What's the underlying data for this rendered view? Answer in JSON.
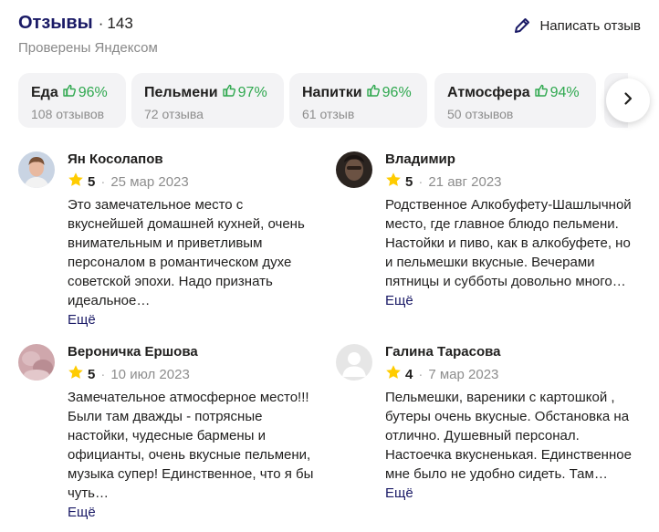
{
  "header": {
    "title": "Отзывы",
    "dot": "·",
    "count": "143",
    "verified": "Проверены Яндексом",
    "write_label": "Написать отзыв"
  },
  "chips": [
    {
      "name": "Еда",
      "percent": "96%",
      "sub": "108 отзывов"
    },
    {
      "name": "Пельмени",
      "percent": "97%",
      "sub": "72 отзыва"
    },
    {
      "name": "Напитки",
      "percent": "96%",
      "sub": "61 отзыв"
    },
    {
      "name": "Атмосфера",
      "percent": "94%",
      "sub": "50 отзывов"
    }
  ],
  "reviews": [
    {
      "author": "Ян Косолапов",
      "rating": "5",
      "date": "25 мар 2023",
      "text": "Это замечательное место с вкуснейшей домашней кухней, очень внимательным и приветливым персоналом в романтическом духе советской эпохи. Надо признать идеальное…",
      "more": "Ещё"
    },
    {
      "author": "Владимир",
      "rating": "5",
      "date": "21 авг 2023",
      "text": "Родственное Алкобуфету-Шашлычной место, где главное блюдо пельмени. Настойки и пиво, как в алкобуфете, но и пельмешки вкусные. Вечерами пятницы и субботы довольно много…",
      "more": "Ещё"
    },
    {
      "author": "Вероничка Ершова",
      "rating": "5",
      "date": "10 июл 2023",
      "text": "Замечательное атмосферное место!!! Были там дважды - потрясные настойки, чудесные бармены и официанты, очень вкусные пельмени, музыка супер! Единственное, что я бы чуть…",
      "more": "Ещё"
    },
    {
      "author": "Галина Тарасова",
      "rating": "4",
      "date": "7 мар 2023",
      "text": "Пельмешки, вареники с картошкой , бутеры очень вкусные. Обстановка на отлично. Душевный персонал. Настоечка вкусненькая. Единственное мне было не удобно сидеть. Там…",
      "more": "Ещё"
    }
  ],
  "icons": {
    "write": "pencil-icon",
    "chip_thumb": "thumbs-up-icon",
    "star": "star-icon",
    "arrow": "chevron-right-icon"
  },
  "colors": {
    "title": "#1a1a66",
    "positive": "#2fa84f",
    "star": "#ffcc00",
    "chip_bg": "#f3f3f5",
    "muted": "#8d8d8d"
  }
}
